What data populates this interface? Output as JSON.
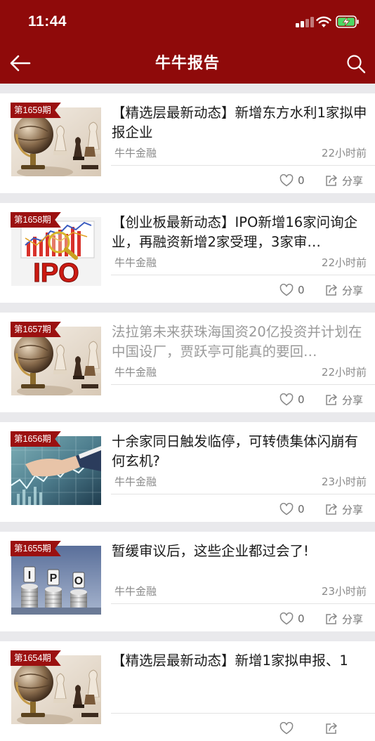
{
  "status_bar": {
    "time": "11:44"
  },
  "nav": {
    "title": "牛牛报告"
  },
  "articles": [
    {
      "issue": "第1659期",
      "title": "【精选层最新动态】新增东方水利1家拟申报企业",
      "source": "牛牛金融",
      "time_ago": "22小时前",
      "likes": "0",
      "share_label": "分享",
      "thumb": "globe-chess",
      "read": false
    },
    {
      "issue": "第1658期",
      "title": "【创业板最新动态】IPO新增16家问询企业，再融资新增2家受理，3家审…",
      "source": "牛牛金融",
      "time_ago": "22小时前",
      "likes": "0",
      "share_label": "分享",
      "thumb": "ipo-chart",
      "read": false
    },
    {
      "issue": "第1657期",
      "title": "法拉第未来获珠海国资20亿投资并计划在中国设厂，贾跃亭可能真的要回…",
      "source": "牛牛金融",
      "time_ago": "22小时前",
      "likes": "0",
      "share_label": "分享",
      "thumb": "globe-chess",
      "read": true
    },
    {
      "issue": "第1656期",
      "title": "十余家同日触发临停，可转债集体闪崩有何玄机?",
      "source": "牛牛金融",
      "time_ago": "23小时前",
      "likes": "0",
      "share_label": "分享",
      "thumb": "hand-chart",
      "read": false
    },
    {
      "issue": "第1655期",
      "title": "暂缓审议后，这些企业都过会了!",
      "source": "牛牛金融",
      "time_ago": "23小时前",
      "likes": "0",
      "share_label": "分享",
      "thumb": "ipo-coins",
      "read": false
    },
    {
      "issue": "第1654期",
      "title": "【精选层最新动态】新增1家拟申报、1",
      "source": "",
      "time_ago": "",
      "likes": "",
      "share_label": "",
      "thumb": "globe-chess",
      "read": false
    }
  ],
  "colors": {
    "brand": "#8f0a0a",
    "badge": "#9b1010"
  }
}
